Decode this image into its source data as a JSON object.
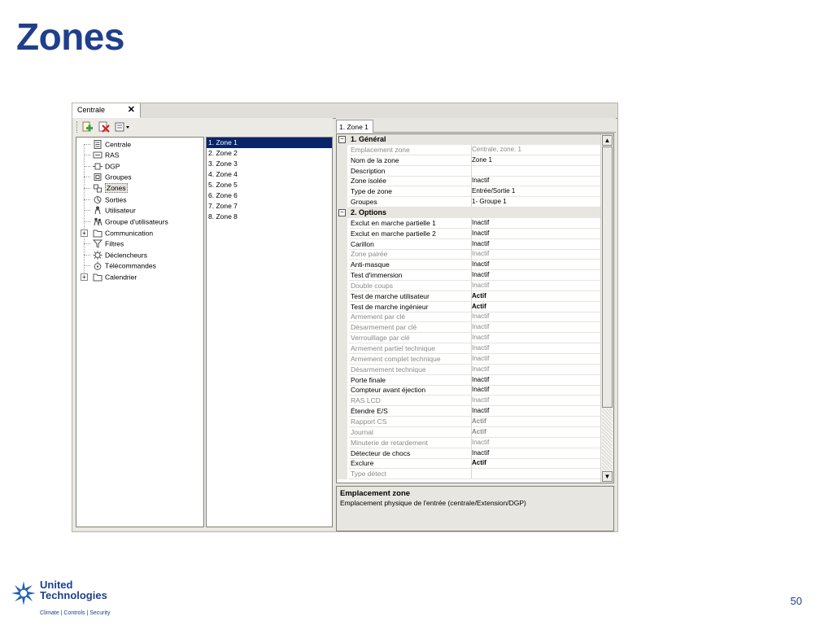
{
  "slide": {
    "title": "Zones",
    "page_number": "50"
  },
  "window": {
    "document_tab": "Centrale",
    "close_glyph": "✕"
  },
  "tree": {
    "items": [
      {
        "label": "Centrale",
        "icon": "panel-icon"
      },
      {
        "label": "RAS",
        "icon": "keypad-icon"
      },
      {
        "label": "DGP",
        "icon": "dgp-icon"
      },
      {
        "label": "Groupes",
        "icon": "groups-icon"
      },
      {
        "label": "Zones",
        "icon": "zones-icon"
      },
      {
        "label": "Sorties",
        "icon": "outputs-icon"
      },
      {
        "label": "Utilisateur",
        "icon": "user-icon"
      },
      {
        "label": "Groupe d'utilisateurs",
        "icon": "user-group-icon"
      },
      {
        "label": "Communication",
        "icon": "folder-icon"
      },
      {
        "label": "Filtres",
        "icon": "filter-icon"
      },
      {
        "label": "Déclencheurs",
        "icon": "trigger-icon"
      },
      {
        "label": "Télécommandes",
        "icon": "remote-icon"
      },
      {
        "label": "Calendrier",
        "icon": "folder-icon"
      }
    ]
  },
  "zone_list": [
    "1. Zone 1",
    "2. Zone 2",
    "3. Zone 3",
    "4. Zone 4",
    "5. Zone 5",
    "6. Zone 6",
    "7. Zone 7",
    "8. Zone 8"
  ],
  "property_tab": "1. Zone 1",
  "properties": {
    "cat1": "1. Général",
    "general": [
      {
        "name": "Emplacement zone",
        "value": "Centrale, zone: 1",
        "dim": true
      },
      {
        "name": "Nom de la zone",
        "value": "Zone 1"
      },
      {
        "name": "Description",
        "value": ""
      },
      {
        "name": "Zone isolée",
        "value": "Inactif"
      },
      {
        "name": "Type de zone",
        "value": "Entrée/Sortie 1"
      },
      {
        "name": "Groupes",
        "value": "1- Groupe 1"
      }
    ],
    "cat2": "2. Options",
    "options": [
      {
        "name": "Exclut en marche partielle 1",
        "value": "Inactif"
      },
      {
        "name": "Exclut en marche partielle 2",
        "value": "Inactif"
      },
      {
        "name": "Carillon",
        "value": "Inactif"
      },
      {
        "name": "Zone pairée",
        "value": "Inactif",
        "dim": true
      },
      {
        "name": "Anti-masque",
        "value": "Inactif"
      },
      {
        "name": "Test d'immersion",
        "value": "Inactif"
      },
      {
        "name": "Double coups",
        "value": "Inactif",
        "dim": true
      },
      {
        "name": "Test de marche utilisateur",
        "value": "Actif",
        "bold": true
      },
      {
        "name": "Test de marche ingénieur",
        "value": "Actif",
        "bold": true
      },
      {
        "name": "Armement par clé",
        "value": "Inactif",
        "dim": true
      },
      {
        "name": "Désarmement par clé",
        "value": "Inactif",
        "dim": true
      },
      {
        "name": "Verrouillage par clé",
        "value": "Inactif",
        "dim": true
      },
      {
        "name": "Armement partiel technique",
        "value": "Inactif",
        "dim": true
      },
      {
        "name": "Armement complet technique",
        "value": "Inactif",
        "dim": true
      },
      {
        "name": "Désarmement technique",
        "value": "Inactif",
        "dim": true
      },
      {
        "name": "Porte finale",
        "value": "Inactif"
      },
      {
        "name": "Compteur avant éjection",
        "value": "Inactif"
      },
      {
        "name": "RAS LCD",
        "value": "Inactif",
        "dim": true
      },
      {
        "name": "Étendre E/S",
        "value": "Inactif"
      },
      {
        "name": "Rapport CS",
        "value": "Actif",
        "dim": true,
        "bold": true
      },
      {
        "name": "Journal",
        "value": "Actif",
        "dim": true,
        "bold": true
      },
      {
        "name": "Minuterie de retardement",
        "value": "Inactif",
        "dim": true
      },
      {
        "name": "Détecteur de chocs",
        "value": "Inactif"
      },
      {
        "name": "Exclure",
        "value": "Actif",
        "bold": true
      },
      {
        "name": "Type détect",
        "value": "",
        "dim": true
      }
    ]
  },
  "help": {
    "title": "Emplacement zone",
    "description": "Emplacement physique de l'entrée (centrale/Extension/DGP)"
  },
  "logo": {
    "line1": "United",
    "line2": "Technologies",
    "tagline": "Climate | Controls | Security"
  },
  "colors": {
    "title_blue": "#1f3f8c",
    "selection": "#0a246a"
  }
}
